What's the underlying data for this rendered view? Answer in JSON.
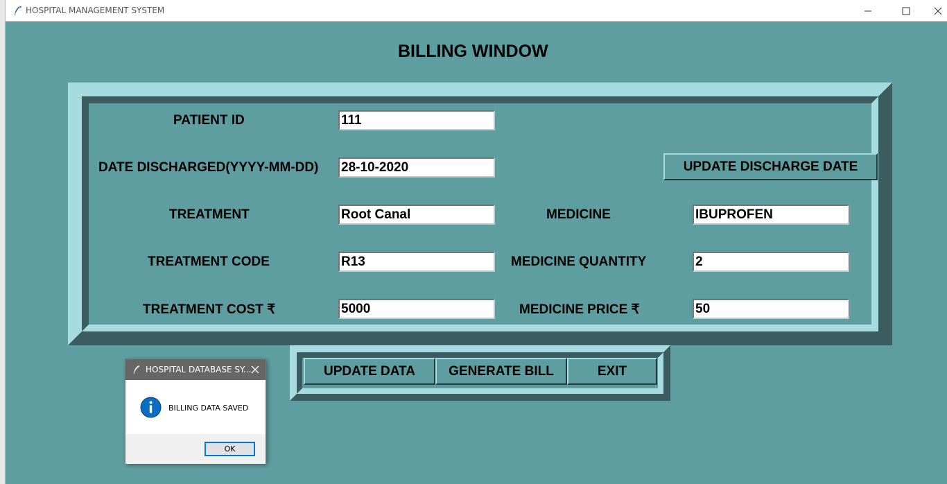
{
  "window": {
    "title": "HOSPITAL MANAGEMENT SYSTEM"
  },
  "page": {
    "title": "BILLING WINDOW"
  },
  "form": {
    "patient_id": {
      "label": "PATIENT ID",
      "value": "111"
    },
    "date_discharged": {
      "label": "DATE DISCHARGED(YYYY-MM-DD)",
      "value": "28-10-2020"
    },
    "treatment": {
      "label": "TREATMENT",
      "value": "Root Canal"
    },
    "treatment_code": {
      "label": "TREATMENT CODE",
      "value": "R13"
    },
    "treatment_cost": {
      "label": "TREATMENT COST ₹",
      "value": "5000"
    },
    "medicine": {
      "label": "MEDICINE",
      "value": "IBUPROFEN"
    },
    "medicine_quantity": {
      "label": "MEDICINE QUANTITY",
      "value": "2"
    },
    "medicine_price": {
      "label": "MEDICINE PRICE ₹",
      "value": "50"
    }
  },
  "buttons": {
    "update_discharge_date": "UPDATE DISCHARGE DATE",
    "update_data": "UPDATE DATA",
    "generate_bill": "GENERATE BILL",
    "exit": "EXIT"
  },
  "dialog": {
    "title": "HOSPITAL DATABASE SY...",
    "message": "BILLING DATA SAVED",
    "ok_label": "OK",
    "icon": "info-icon"
  },
  "colors": {
    "background": "#5f9ea0",
    "frame_light": "#a6dcdf",
    "frame_dark": "#3c5d5f",
    "dialog_title_bar": "#666666",
    "info_blue": "#0a6fc2"
  }
}
